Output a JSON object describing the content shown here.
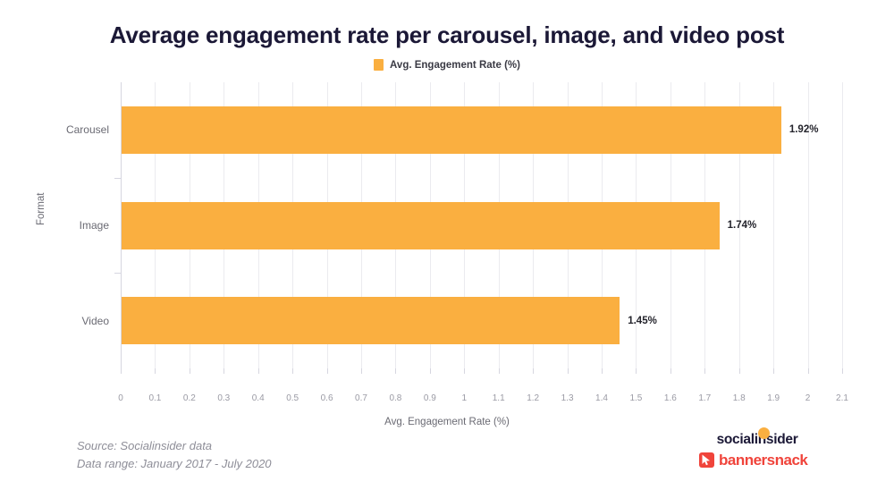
{
  "chart_data": {
    "type": "bar",
    "orientation": "horizontal",
    "title": "Average engagement rate per carousel, image, and video post",
    "categories": [
      "Carousel",
      "Image",
      "Video"
    ],
    "values": [
      1.92,
      1.74,
      1.45
    ],
    "value_labels": [
      "1.92%",
      "1.74%",
      "1.45%"
    ],
    "series": [
      {
        "name": "Avg. Engagement Rate (%)",
        "values": [
          1.92,
          1.74,
          1.45
        ],
        "color": "#FAAF40"
      }
    ],
    "xlabel": "Avg. Engagement Rate (%)",
    "ylabel": "Format",
    "xlim": [
      0,
      2.1
    ],
    "xticks": [
      "0",
      "0.1",
      "0.2",
      "0.3",
      "0.4",
      "0.5",
      "0.6",
      "0.7",
      "0.8",
      "0.9",
      "1",
      "1.1",
      "1.2",
      "1.3",
      "1.4",
      "1.5",
      "1.6",
      "1.7",
      "1.8",
      "1.9",
      "2",
      "2.1"
    ],
    "xtick_values": [
      0,
      0.1,
      0.2,
      0.3,
      0.4,
      0.5,
      0.6,
      0.7,
      0.8,
      0.9,
      1.0,
      1.1,
      1.2,
      1.3,
      1.4,
      1.5,
      1.6,
      1.7,
      1.8,
      1.9,
      2.0,
      2.1
    ],
    "grid": true,
    "grid_axis": "x",
    "legend_position": "top-center",
    "legend": [
      "Avg. Engagement Rate (%)"
    ]
  },
  "legend": {
    "label": "Avg. Engagement Rate (%)"
  },
  "axes": {
    "x_title": "Avg. Engagement Rate (%)",
    "y_title": "Format"
  },
  "footer": {
    "source": "Source: Socialinsider data",
    "range": "Data range: January 2017 - July 2020"
  },
  "logos": {
    "socialinsider": "socialinsider",
    "bannersnack": "bannersnack"
  },
  "colors": {
    "bar": "#FAAF40",
    "title": "#1b1836",
    "grid": "#ebebef",
    "bannersnack_red": "#F0443B"
  }
}
